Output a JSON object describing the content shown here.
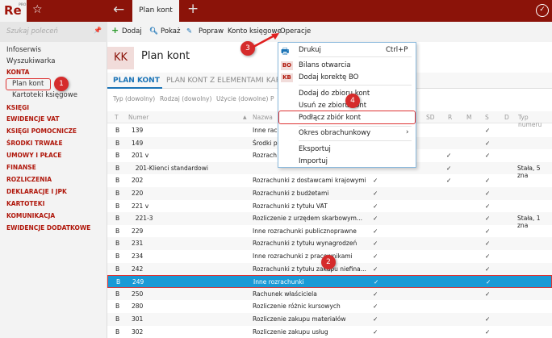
{
  "app": {
    "logo": "Re",
    "logo_sup": "PRO",
    "tab": "Plan kont"
  },
  "sidebar": {
    "search_placeholder": "Szukaj poleceń",
    "items": [
      {
        "label": "Infoserwis",
        "type": "item"
      },
      {
        "label": "Wyszukiwarka",
        "type": "item"
      },
      {
        "label": "KONTA",
        "type": "sec"
      },
      {
        "label": "Plan kont",
        "type": "sub"
      },
      {
        "label": "Kartoteki księgowe",
        "type": "sub"
      },
      {
        "label": "KSIĘGI",
        "type": "sec"
      },
      {
        "label": "EWIDENCJE VAT",
        "type": "sec"
      },
      {
        "label": "KSIĘGI POMOCNICZE",
        "type": "sec"
      },
      {
        "label": "ŚRODKI TRWAŁE",
        "type": "sec"
      },
      {
        "label": "UMOWY I PŁACE",
        "type": "sec"
      },
      {
        "label": "FINANSE",
        "type": "sec"
      },
      {
        "label": "ROZLICZENIA",
        "type": "sec"
      },
      {
        "label": "DEKLARACJE I JPK",
        "type": "sec"
      },
      {
        "label": "KARTOTEKI",
        "type": "sec"
      },
      {
        "label": "KOMUNIKACJA",
        "type": "sec"
      },
      {
        "label": "EWIDENCJE DODATKOWE",
        "type": "sec"
      }
    ]
  },
  "toolbar": {
    "add": "Dodaj",
    "show": "Pokaż",
    "edit": "Popraw",
    "account": "Konto księgowe",
    "ops": "Operacje"
  },
  "page": {
    "badge": "KK",
    "title": "Plan kont",
    "tabs": [
      "PLAN KONT",
      "PLAN KONT Z ELEMENTAMI KAR"
    ],
    "filters": [
      "Typ (dowolny)",
      "Rodzaj (dowolny)",
      "Użycie (dowolne)",
      "P"
    ]
  },
  "table": {
    "headers": [
      "T",
      "Numer",
      "Nazwa",
      "SD",
      "R",
      "M",
      "S",
      "D",
      "Typ numeru"
    ],
    "rows": [
      {
        "t": "B",
        "num": "139",
        "name": "Inne rac",
        "c": "",
        "r": "",
        "s": "✓",
        "typ": ""
      },
      {
        "t": "B",
        "num": "149",
        "name": "Środki p",
        "c": "",
        "r": "",
        "s": "✓",
        "typ": ""
      },
      {
        "t": "B",
        "num": "201 v",
        "name": "Rozrach",
        "c": "",
        "r": "✓",
        "s": "✓",
        "typ": ""
      },
      {
        "t": "B",
        "num": "  201-Klienci standardowi",
        "name": "",
        "c": "",
        "r": "✓",
        "s": "",
        "typ": "Stała, 5 zna"
      },
      {
        "t": "B",
        "num": "202",
        "name": "Rozrachunki z dostawcami krajowymi",
        "c": "✓",
        "r": "✓",
        "s": "✓",
        "typ": ""
      },
      {
        "t": "B",
        "num": "220",
        "name": "Rozrachunki z budżetami",
        "c": "✓",
        "r": "",
        "s": "✓",
        "typ": ""
      },
      {
        "t": "B",
        "num": "221 v",
        "name": "Rozrachunki z tytułu VAT",
        "c": "✓",
        "r": "",
        "s": "✓",
        "typ": ""
      },
      {
        "t": "B",
        "num": "  221-3",
        "name": "Rozliczenie z urzędem skarbowym...",
        "c": "✓",
        "r": "",
        "s": "✓",
        "typ": "Stała, 1 zna"
      },
      {
        "t": "B",
        "num": "229",
        "name": "Inne rozrachunki publicznoprawne",
        "c": "✓",
        "r": "",
        "s": "✓",
        "typ": ""
      },
      {
        "t": "B",
        "num": "231",
        "name": "Rozrachunki z tytułu wynagrodzeń",
        "c": "✓",
        "r": "",
        "s": "✓",
        "typ": ""
      },
      {
        "t": "B",
        "num": "234",
        "name": "Inne rozrachunki z pracownikami",
        "c": "✓",
        "r": "",
        "s": "✓",
        "typ": ""
      },
      {
        "t": "B",
        "num": "242",
        "name": "Rozrachunki z tytułu zakupu niefina...",
        "c": "✓",
        "r": "",
        "s": "✓",
        "typ": ""
      },
      {
        "t": "B",
        "num": "249",
        "name": "Inne rozrachunki",
        "c": "✓",
        "r": "",
        "s": "✓",
        "typ": "",
        "selected": true
      },
      {
        "t": "B",
        "num": "250",
        "name": "Rachunek właściciela",
        "c": "✓",
        "r": "",
        "s": "✓",
        "typ": ""
      },
      {
        "t": "B",
        "num": "280",
        "name": "Rozliczenie różnic kursowych",
        "c": "✓",
        "r": "",
        "s": "",
        "typ": ""
      },
      {
        "t": "B",
        "num": "301",
        "name": "Rozliczenie zakupu materiałów",
        "c": "✓",
        "r": "",
        "s": "✓",
        "typ": ""
      },
      {
        "t": "B",
        "num": "302",
        "name": "Rozliczenie zakupu usług",
        "c": "✓",
        "r": "",
        "s": "✓",
        "typ": ""
      }
    ]
  },
  "menu": {
    "print": "Drukuj",
    "print_shortcut": "Ctrl+P",
    "bo_icon": "BO",
    "bo": "Bilans otwarcia",
    "kb_icon": "KB",
    "kb": "Dodaj korektę BO",
    "add_set": "Dodaj do zbioru kont",
    "remove_set": "Usuń ze zbioru kont",
    "attach_set": "Podłącz zbiór kont",
    "period": "Okres obrachunkowy",
    "export": "Eksportuj",
    "import": "Importuj"
  },
  "annotations": [
    "1",
    "2",
    "3",
    "4"
  ]
}
